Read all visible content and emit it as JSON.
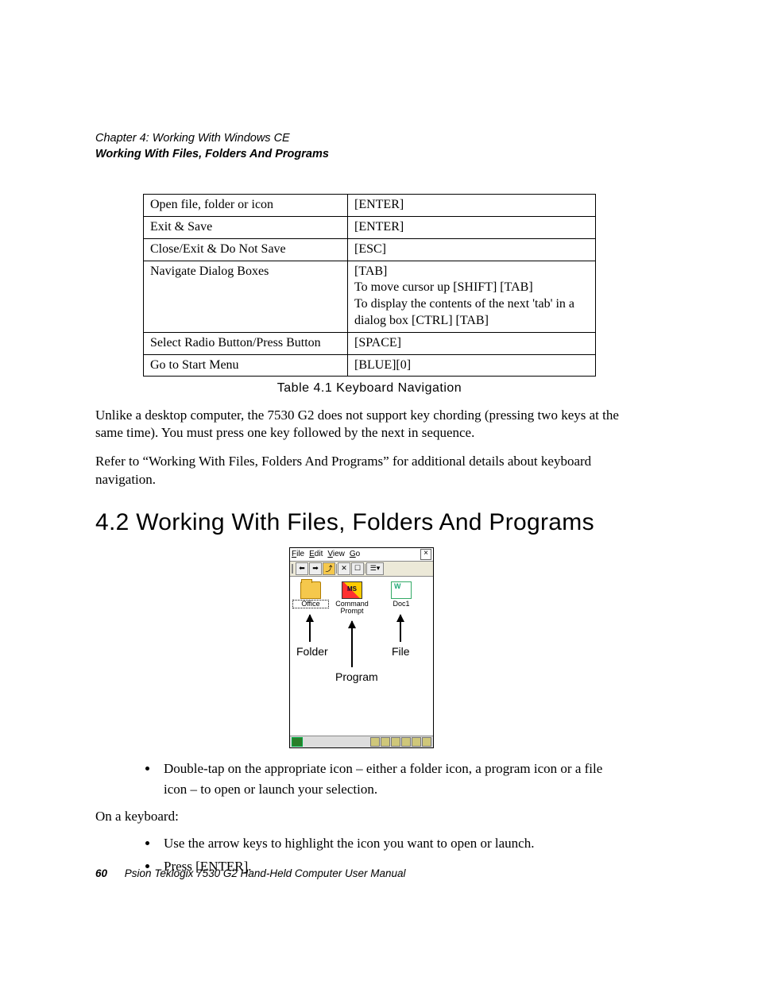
{
  "header": {
    "chapter": "Chapter  4:  Working With Windows CE",
    "section": "Working With Files, Folders And Programs"
  },
  "table": {
    "rows": [
      {
        "action": "Open file, folder or icon",
        "key": "[ENTER]"
      },
      {
        "action": "Exit & Save",
        "key": "[ENTER]"
      },
      {
        "action": "Close/Exit & Do Not Save",
        "key": "[ESC]"
      },
      {
        "action": "Navigate Dialog Boxes",
        "key": "[TAB]\nTo move cursor up [SHIFT] [TAB]\nTo display the contents of the next 'tab' in a dialog box [CTRL] [TAB]"
      },
      {
        "action": "Select Radio Button/Press Button",
        "key": "[SPACE]"
      },
      {
        "action": "Go to Start Menu",
        "key": "[BLUE][0]"
      }
    ],
    "caption": "Table 4.1   Keyboard Navigation"
  },
  "para1": "Unlike a desktop computer, the 7530 G2 does not support key chording (pressing two keys at the same time). You must press one key followed by the next in sequence.",
  "para2": "Refer to “Working With Files, Folders And Programs” for additional details about keyboard navigation.",
  "heading": "4.2   Working With Files, Folders And Programs",
  "figure": {
    "menu": {
      "file": "File",
      "edit": "Edit",
      "view": "View",
      "go": "Go",
      "close": "×"
    },
    "icons": {
      "folder": "Office",
      "program": "Command Prompt",
      "file": "Doc1"
    },
    "annotations": {
      "folder": "Folder",
      "program": "Program",
      "file": "File"
    }
  },
  "bullet1": "Double-tap on the appropriate icon – either a folder icon, a program icon or a file icon – to open or launch your selection.",
  "para3": "On a keyboard:",
  "bullet2": "Use the arrow keys to highlight the icon you want to open or launch.",
  "bullet3": "Press [ENTER].",
  "footer": {
    "page": "60",
    "title": "Psion Teklogix 7530 G2 Hand-Held Computer User Manual"
  }
}
